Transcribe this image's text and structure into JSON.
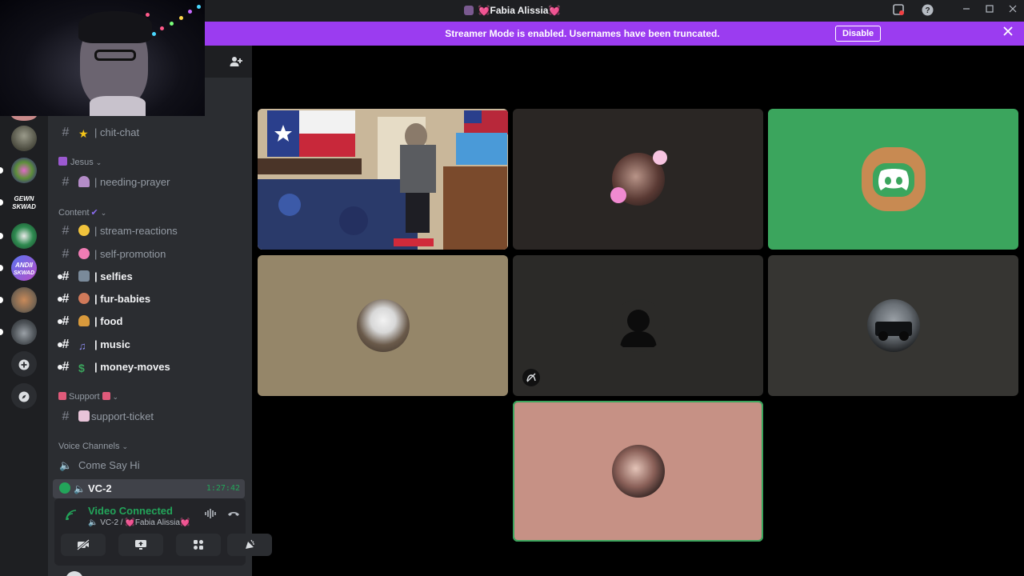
{
  "window": {
    "title": "Fabia Alissia",
    "title_hearts_left": "💓",
    "title_hearts_right": "💓"
  },
  "banner": {
    "message": "Streamer Mode is enabled. Usernames have been truncated.",
    "disable_label": "Disable"
  },
  "channels": {
    "chit_chat": "| chit-chat",
    "cat_jesus": "Jesus",
    "needing_prayer": "| needing-prayer",
    "cat_content": "Content",
    "stream_reactions": "| stream-reactions",
    "self_promotion": "| self-promotion",
    "selfies": "| selfies",
    "fur_babies": "| fur-babies",
    "food": "| food",
    "music": "| music",
    "money_moves": "| money-moves",
    "cat_support": "Support",
    "support_ticket": "support-ticket",
    "cat_voice": "Voice Channels",
    "come_say_hi": "Come Say Hi",
    "vc2": "VC-2",
    "vc2_time": "1:27:42"
  },
  "voice_panel": {
    "status": "Video Connected",
    "channel": "VC-2 / ",
    "user": "Fabia Alissia"
  },
  "colors": {
    "accent": "#9b3cf0",
    "connected": "#23a55a",
    "tile_green": "#3ba55d",
    "tile_tan": "#958669",
    "tile_pink": "#c69185",
    "tile_dark": "#2b2a28"
  },
  "icons": {
    "invite": "add-user-icon",
    "signal": "signal-icon",
    "hangup": "hangup-icon"
  }
}
